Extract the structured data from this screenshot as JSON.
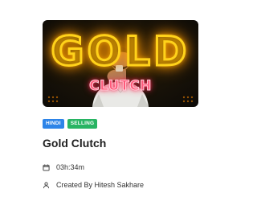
{
  "course": {
    "thumbnail": {
      "headline": "GOLD",
      "subtitle": "CLUTCH"
    },
    "badges": {
      "language": "HINDI",
      "status": "SELLING"
    },
    "title": "Gold Clutch",
    "duration": "03h:34m",
    "author_line": "Created By Hitesh Sakhare",
    "icons": {
      "duration": "calendar-icon",
      "author": "person-icon"
    },
    "colors": {
      "language_badge": "#2d84e8",
      "status_badge": "#28b463",
      "neon_gold": "#ffd21a",
      "neon_pink": "#ff5a7a"
    }
  }
}
